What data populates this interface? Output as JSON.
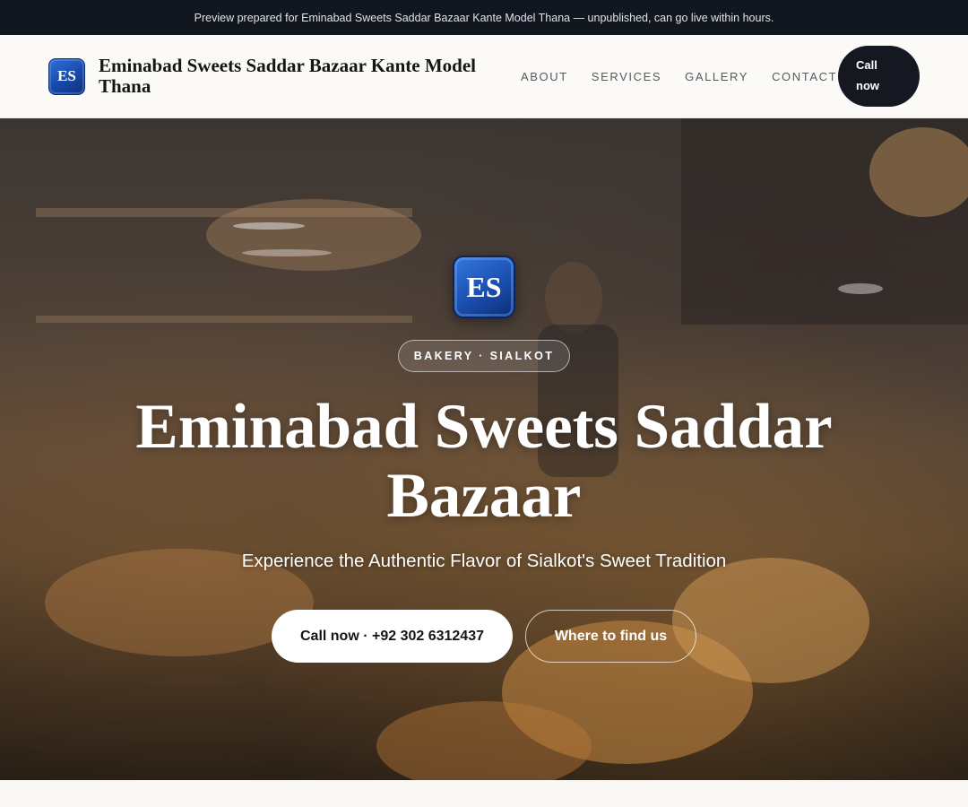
{
  "banner": {
    "text": "Preview prepared for Eminabad Sweets Saddar Bazaar Kante Model Thana — unpublished, can go live within hours."
  },
  "header": {
    "logo_text": "ES",
    "brand_name": "Eminabad Sweets Saddar Bazaar Kante Model Thana",
    "nav": {
      "about": "ABOUT",
      "services": "SERVICES",
      "gallery": "GALLERY",
      "contact": "CONTACT"
    },
    "call_label": "Call now"
  },
  "hero": {
    "logo_text": "ES",
    "category": "BAKERY · SIALKOT",
    "title": "Eminabad Sweets Saddar Bazaar",
    "subtitle": "Experience the Authentic Flavor of Sialkot's Sweet Tradition",
    "primary_button": "Call now · +92 302 6312437",
    "secondary_button": "Where to find us",
    "background_image": "bakery-counter-photo"
  },
  "colors": {
    "banner_bg": "#12161f",
    "header_bg": "#fbfaf7",
    "accent_dark": "#151821",
    "logo_blue": "#1a4fb0"
  }
}
